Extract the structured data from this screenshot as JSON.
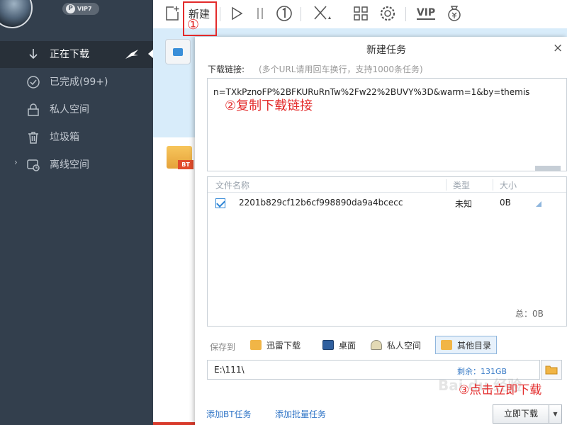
{
  "user": {
    "vip_letter": "P",
    "vip_level": "VIP7"
  },
  "sidebar": {
    "items": [
      {
        "label": "正在下载",
        "icon": "download-arrow-icon",
        "active": true
      },
      {
        "label": "已完成(99+)",
        "icon": "check-circle-icon",
        "active": false
      },
      {
        "label": "私人空间",
        "icon": "lock-icon",
        "active": false
      },
      {
        "label": "垃圾箱",
        "icon": "trash-icon",
        "active": false
      },
      {
        "label": "离线空间",
        "icon": "cloud-offline-icon",
        "active": false
      }
    ]
  },
  "toolbar": {
    "new_label": "新建",
    "vip_label": "VIP",
    "icons": [
      "new-task-icon",
      "start-icon",
      "pause-icon",
      "delete-icon",
      "grid-icon",
      "settings-icon",
      "vip-icon",
      "wallet-icon"
    ]
  },
  "annotations": {
    "step1": "①",
    "step2": "②复制下载链接",
    "step3": "③点击立即下载"
  },
  "list": {
    "bt_tag": "BT"
  },
  "dialog": {
    "title": "新建任务",
    "close": "×",
    "link_label": "下载链接:",
    "link_hint": "(多个URL请用回车换行，支持1000条任务)",
    "link_value": "n=TXkPznoFP%2BFKURuRnTw%2Fw22%2BUVY%3D&warm=1&by=themis",
    "columns": {
      "name": "文件名称",
      "type": "类型",
      "size": "大小"
    },
    "files": [
      {
        "name": "2201b829cf12b6cf998890da9a4bcecc",
        "type": "未知",
        "size": "0B",
        "checked": true
      }
    ],
    "total": "总：0B",
    "save_label": "保存到",
    "destinations": [
      {
        "label": "迅雷下载",
        "icon": "folder-thunder-icon"
      },
      {
        "label": "桌面",
        "icon": "desktop-icon"
      },
      {
        "label": "私人空间",
        "icon": "private-space-icon"
      },
      {
        "label": "其他目录",
        "icon": "folder-other-icon",
        "selected": true
      }
    ],
    "path": "E:\\111\\",
    "free_space": "剩余：131GB",
    "add_bt": "添加BT任务",
    "add_batch": "添加批量任务",
    "download_now": "立即下载"
  },
  "colors": {
    "sidebar_bg": "#333f4d",
    "accent_red": "#e32b2b",
    "link_blue": "#2f74c6",
    "highlight_blue": "#d8ecfa"
  },
  "watermark": "Bai du 经验"
}
